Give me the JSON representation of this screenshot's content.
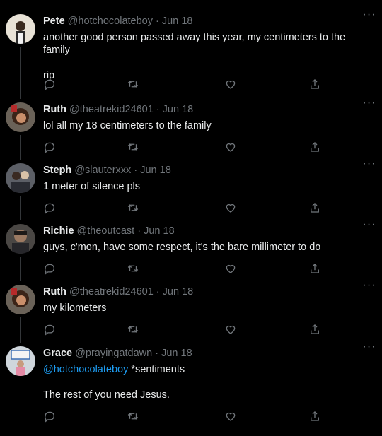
{
  "tweets": [
    {
      "name": "Pete",
      "handle": "@hotchocolateboy",
      "date": "Jun 18",
      "avatar": "avatar-photo",
      "body": [
        "another good person passed away this year, my centimeters to the family",
        "rip"
      ]
    },
    {
      "name": "Ruth",
      "handle": "@theatrekid24601",
      "date": "Jun 18",
      "avatar": "avatar-photo",
      "body": [
        "lol all my 18 centimeters to the family"
      ]
    },
    {
      "name": "Steph",
      "handle": "@slauterxxx",
      "date": "Jun 18",
      "avatar": "avatar-photo",
      "body": [
        "1 meter of silence pls"
      ]
    },
    {
      "name": "Richie",
      "handle": "@theoutcast",
      "date": "Jun 18",
      "avatar": "avatar-photo",
      "body": [
        "guys, c'mon, have some respect, it's the bare millimeter to do"
      ]
    },
    {
      "name": "Ruth",
      "handle": "@theatrekid24601",
      "date": "Jun 18",
      "avatar": "avatar-photo",
      "body": [
        "my kilometers"
      ]
    },
    {
      "name": "Grace",
      "handle": "@prayingatdawn",
      "date": "Jun 18",
      "avatar": "avatar-photo",
      "mention": "@hotchocolateboy",
      "body": [
        "*sentiments",
        "The rest of you need Jesus."
      ]
    }
  ],
  "ui": {
    "separator": "·",
    "more": "···",
    "icons": [
      "reply-icon",
      "retweet-icon",
      "like-icon",
      "share-icon"
    ]
  },
  "colors": {
    "background": "#000000",
    "text": "#e7e9ea",
    "muted": "#71767b",
    "link": "#1d9bf0",
    "thread_line": "#333639"
  }
}
